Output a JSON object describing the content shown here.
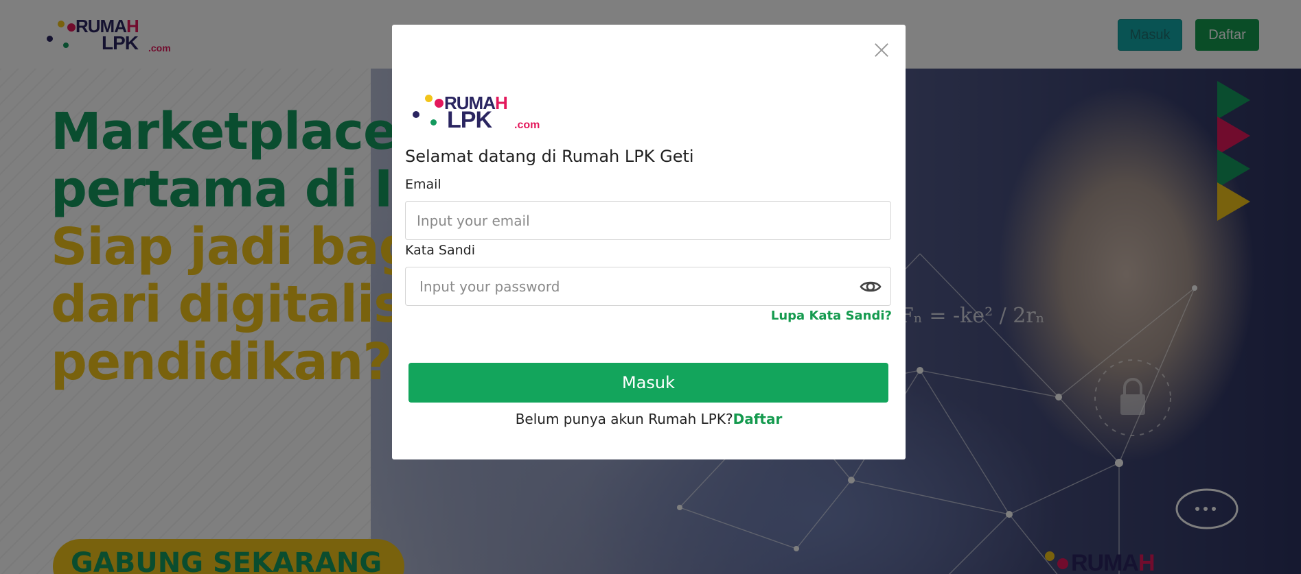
{
  "header": {
    "logo_top": "RUMA",
    "logo_h": "H",
    "logo_bottom": "LPK",
    "logo_com": ".com",
    "login_label": "Masuk",
    "register_label": "Daftar"
  },
  "hero": {
    "line1": "Marketplace L",
    "line2": "pertama di In",
    "line3": "Siap jadi bag",
    "line4": "dari digitalisa",
    "line5": "pendidikan?",
    "cta_label": "GABUNG SEKARANG",
    "formula": "Fₙ = -ke² / 2rₙ"
  },
  "modal": {
    "logo_top": "RUMA",
    "logo_h": "H",
    "logo_bottom": "LPK",
    "logo_com": ".com",
    "title": "Selamat datang di Rumah LPK Geti",
    "email_label": "Email",
    "email_placeholder": "Input your email",
    "password_label": "Kata Sandi",
    "password_placeholder": "Input your password",
    "forgot_label": "Lupa Kata Sandi?",
    "submit_label": "Masuk",
    "signup_text": "Belum punya akun Rumah LPK?",
    "signup_link": "Daftar"
  },
  "colors": {
    "brand_green": "#149a4e",
    "brand_yellow": "#f2c41a",
    "brand_navy": "#2a2560",
    "brand_pink": "#e3185b",
    "teal": "#13a7a7"
  }
}
